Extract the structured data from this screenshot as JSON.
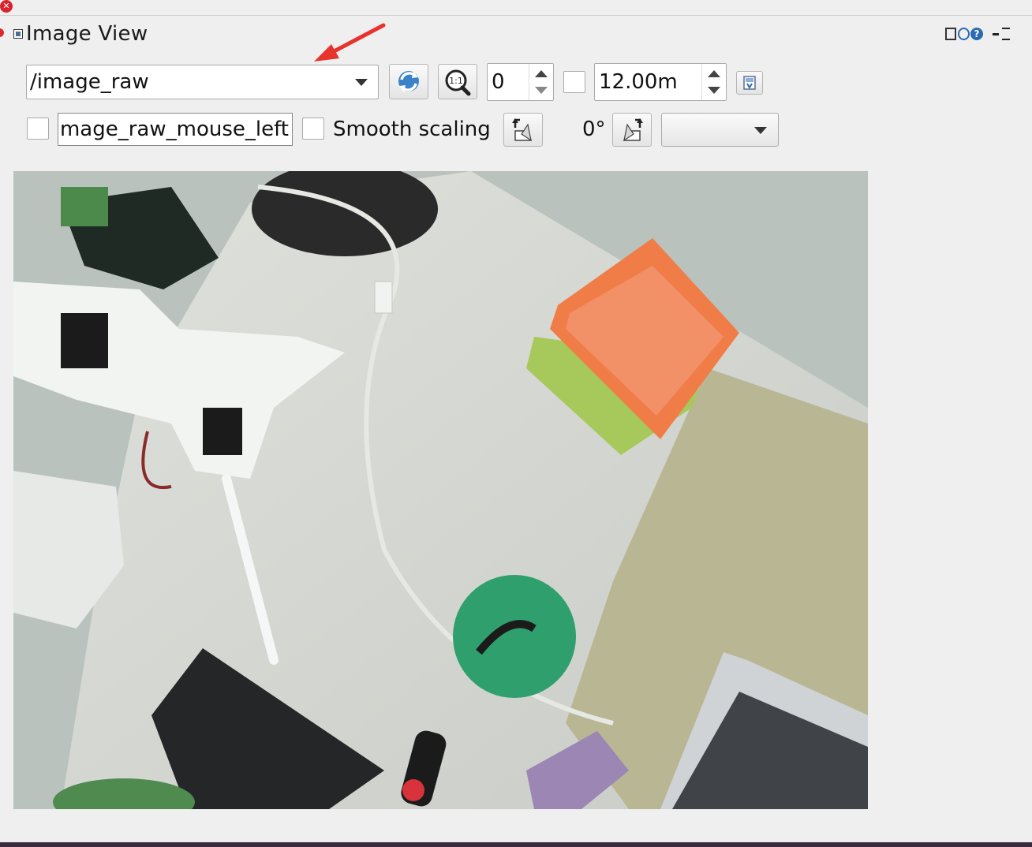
{
  "window": {
    "title": "Image View"
  },
  "toolbar": {
    "topic_value": "/image_raw",
    "frame_value": "0",
    "distance_value": "12.00m",
    "mouse_topic_value": "mage_raw_mouse_left",
    "smooth_scaling_label": "Smooth scaling",
    "rotation_label": "0°",
    "color_scheme_value": ""
  },
  "colors": {
    "title_close": "#d9232e",
    "refresh_blue": "#2a6bb3",
    "annotation_arrow": "#e8332d"
  },
  "icons": {
    "frame": "frame-icon",
    "refresh": "refresh-icon",
    "help": "help-icon",
    "close": "close-icon",
    "zoom": "zoom-1to1-icon",
    "save": "save-icon",
    "rotate_left": "rotate-left-icon",
    "rotate_right": "rotate-right-icon"
  }
}
